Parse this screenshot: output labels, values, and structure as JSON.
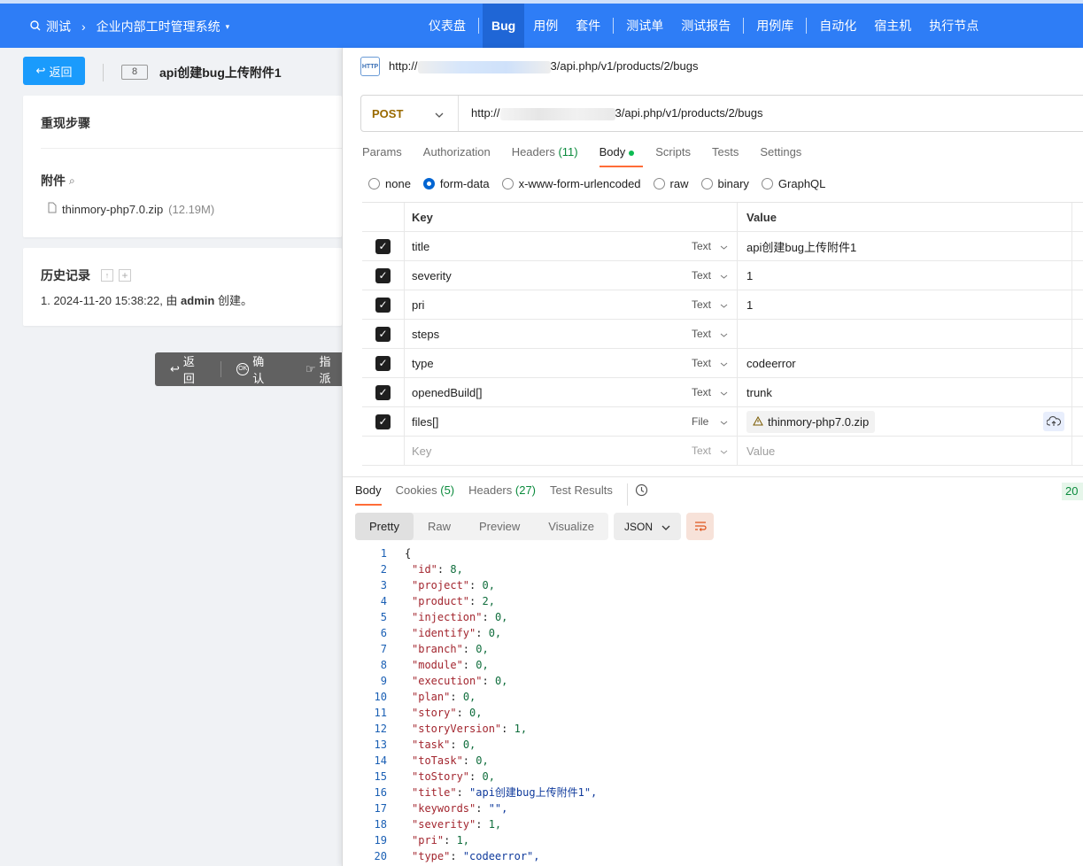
{
  "topbar": {
    "crumb_project": "测试",
    "crumb_system": "企业内部工时管理系统",
    "nav": [
      "仪表盘",
      "Bug",
      "用例",
      "套件",
      "测试单",
      "测试报告",
      "用例库",
      "自动化",
      "宿主机",
      "执行节点"
    ]
  },
  "bug": {
    "back_label": "返回",
    "id": "8",
    "title": "api创建bug上传附件1",
    "steps_heading": "重现步骤",
    "attach_heading": "附件",
    "file_name": "thinmory-php7.0.zip",
    "file_size": "(12.19M)",
    "history_heading": "历史记录",
    "history_prefix": "1. 2024-11-20 15:38:22, 由 ",
    "history_user": "admin",
    "history_suffix": " 创建。",
    "actions": {
      "back": "返回",
      "confirm": "确认",
      "assign": "指派"
    }
  },
  "postman": {
    "url_prefix": "http://",
    "url_suffix": "3/api.php/v1/products/2/bugs",
    "method": "POST",
    "req_url_prefix": "http://",
    "req_url_suffix": "3/api.php/v1/products/2/bugs",
    "tabs": [
      "Params",
      "Authorization",
      "Headers",
      "(11)",
      "Body",
      "Scripts",
      "Tests",
      "Settings"
    ],
    "body_types": [
      "none",
      "form-data",
      "x-www-form-urlencoded",
      "raw",
      "binary",
      "GraphQL"
    ],
    "selected_body_type": "form-data",
    "table_headers": {
      "key": "Key",
      "value": "Value"
    },
    "rows": [
      {
        "key": "title",
        "type": "Text",
        "value": "api创建bug上传附件1"
      },
      {
        "key": "severity",
        "type": "Text",
        "value": "1"
      },
      {
        "key": "pri",
        "type": "Text",
        "value": "1"
      },
      {
        "key": "steps",
        "type": "Text",
        "value": ""
      },
      {
        "key": "type",
        "type": "Text",
        "value": "codeerror"
      },
      {
        "key": "openedBuild[]",
        "type": "Text",
        "value": "trunk"
      },
      {
        "key": "files[]",
        "type": "File",
        "value": "thinmory-php7.0.zip"
      }
    ],
    "placeholder_row": {
      "key": "Key",
      "type": "Text",
      "value": "Value"
    },
    "resp_tabs": [
      "Body",
      "Cookies",
      "(5)",
      "Headers",
      "(27)",
      "Test Results"
    ],
    "status": "20",
    "view_modes": [
      "Pretty",
      "Raw",
      "Preview",
      "Visualize"
    ],
    "format": "JSON",
    "json_lines": [
      {
        "n": "1",
        "t": "{"
      },
      {
        "n": "2",
        "k": "\"id\"",
        "v": "8,"
      },
      {
        "n": "3",
        "k": "\"project\"",
        "v": "0,"
      },
      {
        "n": "4",
        "k": "\"product\"",
        "v": "2,"
      },
      {
        "n": "5",
        "k": "\"injection\"",
        "v": "0,"
      },
      {
        "n": "6",
        "k": "\"identify\"",
        "v": "0,"
      },
      {
        "n": "7",
        "k": "\"branch\"",
        "v": "0,"
      },
      {
        "n": "8",
        "k": "\"module\"",
        "v": "0,"
      },
      {
        "n": "9",
        "k": "\"execution\"",
        "v": "0,"
      },
      {
        "n": "10",
        "k": "\"plan\"",
        "v": "0,"
      },
      {
        "n": "11",
        "k": "\"story\"",
        "v": "0,"
      },
      {
        "n": "12",
        "k": "\"storyVersion\"",
        "v": "1,"
      },
      {
        "n": "13",
        "k": "\"task\"",
        "v": "0,"
      },
      {
        "n": "14",
        "k": "\"toTask\"",
        "v": "0,"
      },
      {
        "n": "15",
        "k": "\"toStory\"",
        "v": "0,"
      },
      {
        "n": "16",
        "k": "\"title\"",
        "s": "\"api创建bug上传附件1\","
      },
      {
        "n": "17",
        "k": "\"keywords\"",
        "s": "\"\","
      },
      {
        "n": "18",
        "k": "\"severity\"",
        "v": "1,"
      },
      {
        "n": "19",
        "k": "\"pri\"",
        "v": "1,"
      },
      {
        "n": "20",
        "k": "\"type\"",
        "s": "\"codeerror\","
      }
    ]
  },
  "colors": {
    "brand": "#2e7df6",
    "accent": "#ff6c37",
    "button": "#1a9bfc"
  }
}
